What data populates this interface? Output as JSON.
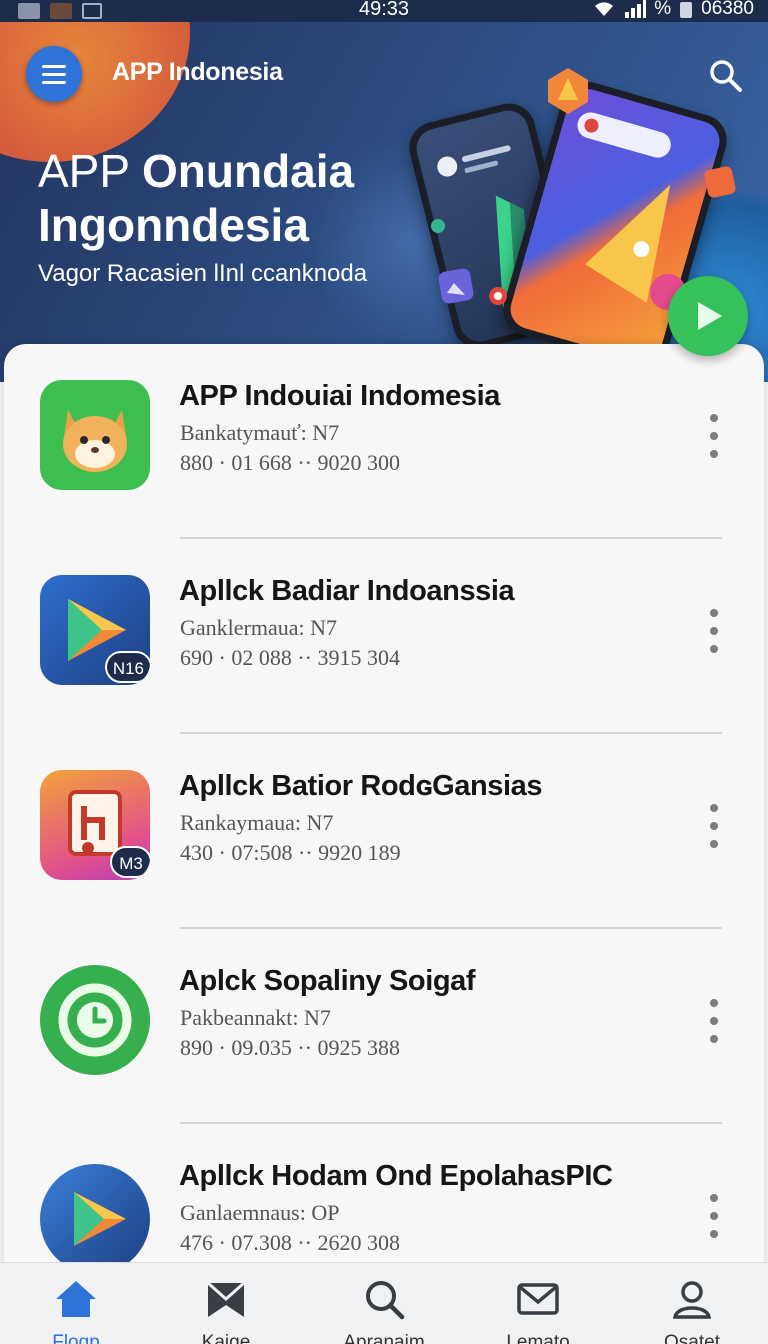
{
  "status_bar": {
    "time": "49:33",
    "right_text": "06380",
    "signal_text": "%"
  },
  "header": {
    "brand": "APP Indonesia"
  },
  "hero": {
    "title_line1_thin": "APP ",
    "title_line1_bold": "Onundaia",
    "title_line2": "Ingonndesia",
    "subtitle": "Vagor Racasien lInl ccanknoda"
  },
  "apps": [
    {
      "title": "APP Indouiai Indomesia",
      "sub": "Bankatymauť:  N7",
      "meta": "880 · 01 668 ·· 9020 300",
      "icon": "cat-icon",
      "badge": ""
    },
    {
      "title": "Apllck Badiar Indoanssia",
      "sub": "Ganklermaua:  N7",
      "meta": "690 · 02 088 ·· 3915 304",
      "icon": "play-triangle-icon",
      "badge": "N16"
    },
    {
      "title": "Apllck Batior RodɢGansias",
      "sub": "Rankaymaua:  N7",
      "meta": "430 · 07:508 ·· 9920 189",
      "icon": "document-icon",
      "badge": "M3"
    },
    {
      "title": "Aplck Sopaliny Soigaf",
      "sub": "Pakbeannakt:  N7",
      "meta": "890 · 09.035 ·· 0925 388",
      "icon": "clock-icon",
      "badge": ""
    },
    {
      "title": "Apllck Hodam Ond  EpolahasPIC",
      "sub": "Ganlaemnaus:  OP",
      "meta": "476 · 07.308 ·· 2620 308",
      "icon": "play-triangle-icon",
      "badge": ""
    }
  ],
  "bottom_nav": [
    {
      "label": "Flogp",
      "icon": "home-icon",
      "active": true
    },
    {
      "label": "Kaige",
      "icon": "bookmark-icon",
      "active": false
    },
    {
      "label": "Apranaim",
      "icon": "search-icon",
      "active": false
    },
    {
      "label": "Lemato",
      "icon": "mail-icon",
      "active": false
    },
    {
      "label": "Osatet",
      "icon": "person-icon",
      "active": false
    }
  ],
  "colors": {
    "accent": "#2f73d9",
    "header_bg": "#23345c",
    "play_green": "#37c15a"
  }
}
